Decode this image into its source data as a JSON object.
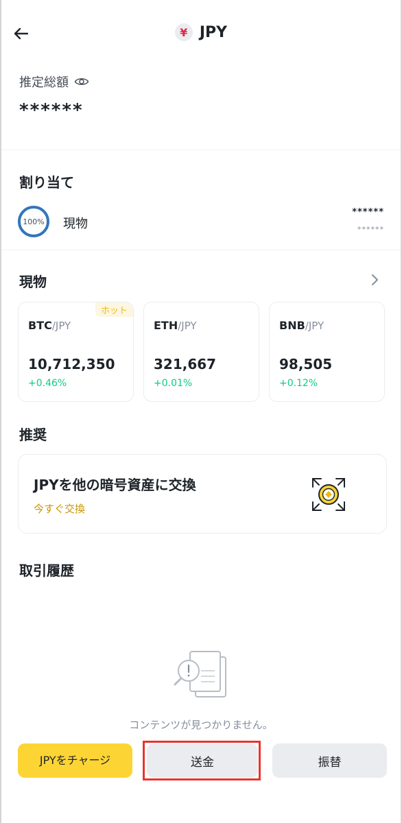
{
  "header": {
    "title": "JPY",
    "coin_symbol": "¥"
  },
  "total": {
    "label": "推定総額",
    "value": "******"
  },
  "allocation": {
    "title": "割り当て",
    "percent": "100%",
    "label": "現物",
    "value_primary": "******",
    "value_secondary": "******"
  },
  "spot": {
    "title": "現物",
    "cards": [
      {
        "base": "BTC",
        "quote": "/JPY",
        "price": "10,712,350",
        "change": "+0.46%",
        "badge": "ホット"
      },
      {
        "base": "ETH",
        "quote": "/JPY",
        "price": "321,667",
        "change": "+0.01%"
      },
      {
        "base": "BNB",
        "quote": "/JPY",
        "price": "98,505",
        "change": "+0.12%"
      }
    ]
  },
  "recommend": {
    "title": "推奨",
    "card_title": "JPYを他の暗号資産に交換",
    "card_link": "今すぐ交換"
  },
  "history": {
    "title": "取引履歴",
    "empty_text": "コンテンツが見つかりません。"
  },
  "actions": {
    "charge_label": "JPYをチャージ",
    "send_label": "送金",
    "transfer_label": "振替"
  },
  "colors": {
    "accent": "#fcd535",
    "positive": "#0ecb81",
    "link": "#c99400",
    "highlight": "#e8342e",
    "ring": "#3375bb"
  },
  "icons": {
    "back": "arrow-left-icon",
    "eye": "eye-icon",
    "chevron": "chevron-right-icon",
    "swap": "swap-icon",
    "empty": "empty-document-icon"
  }
}
